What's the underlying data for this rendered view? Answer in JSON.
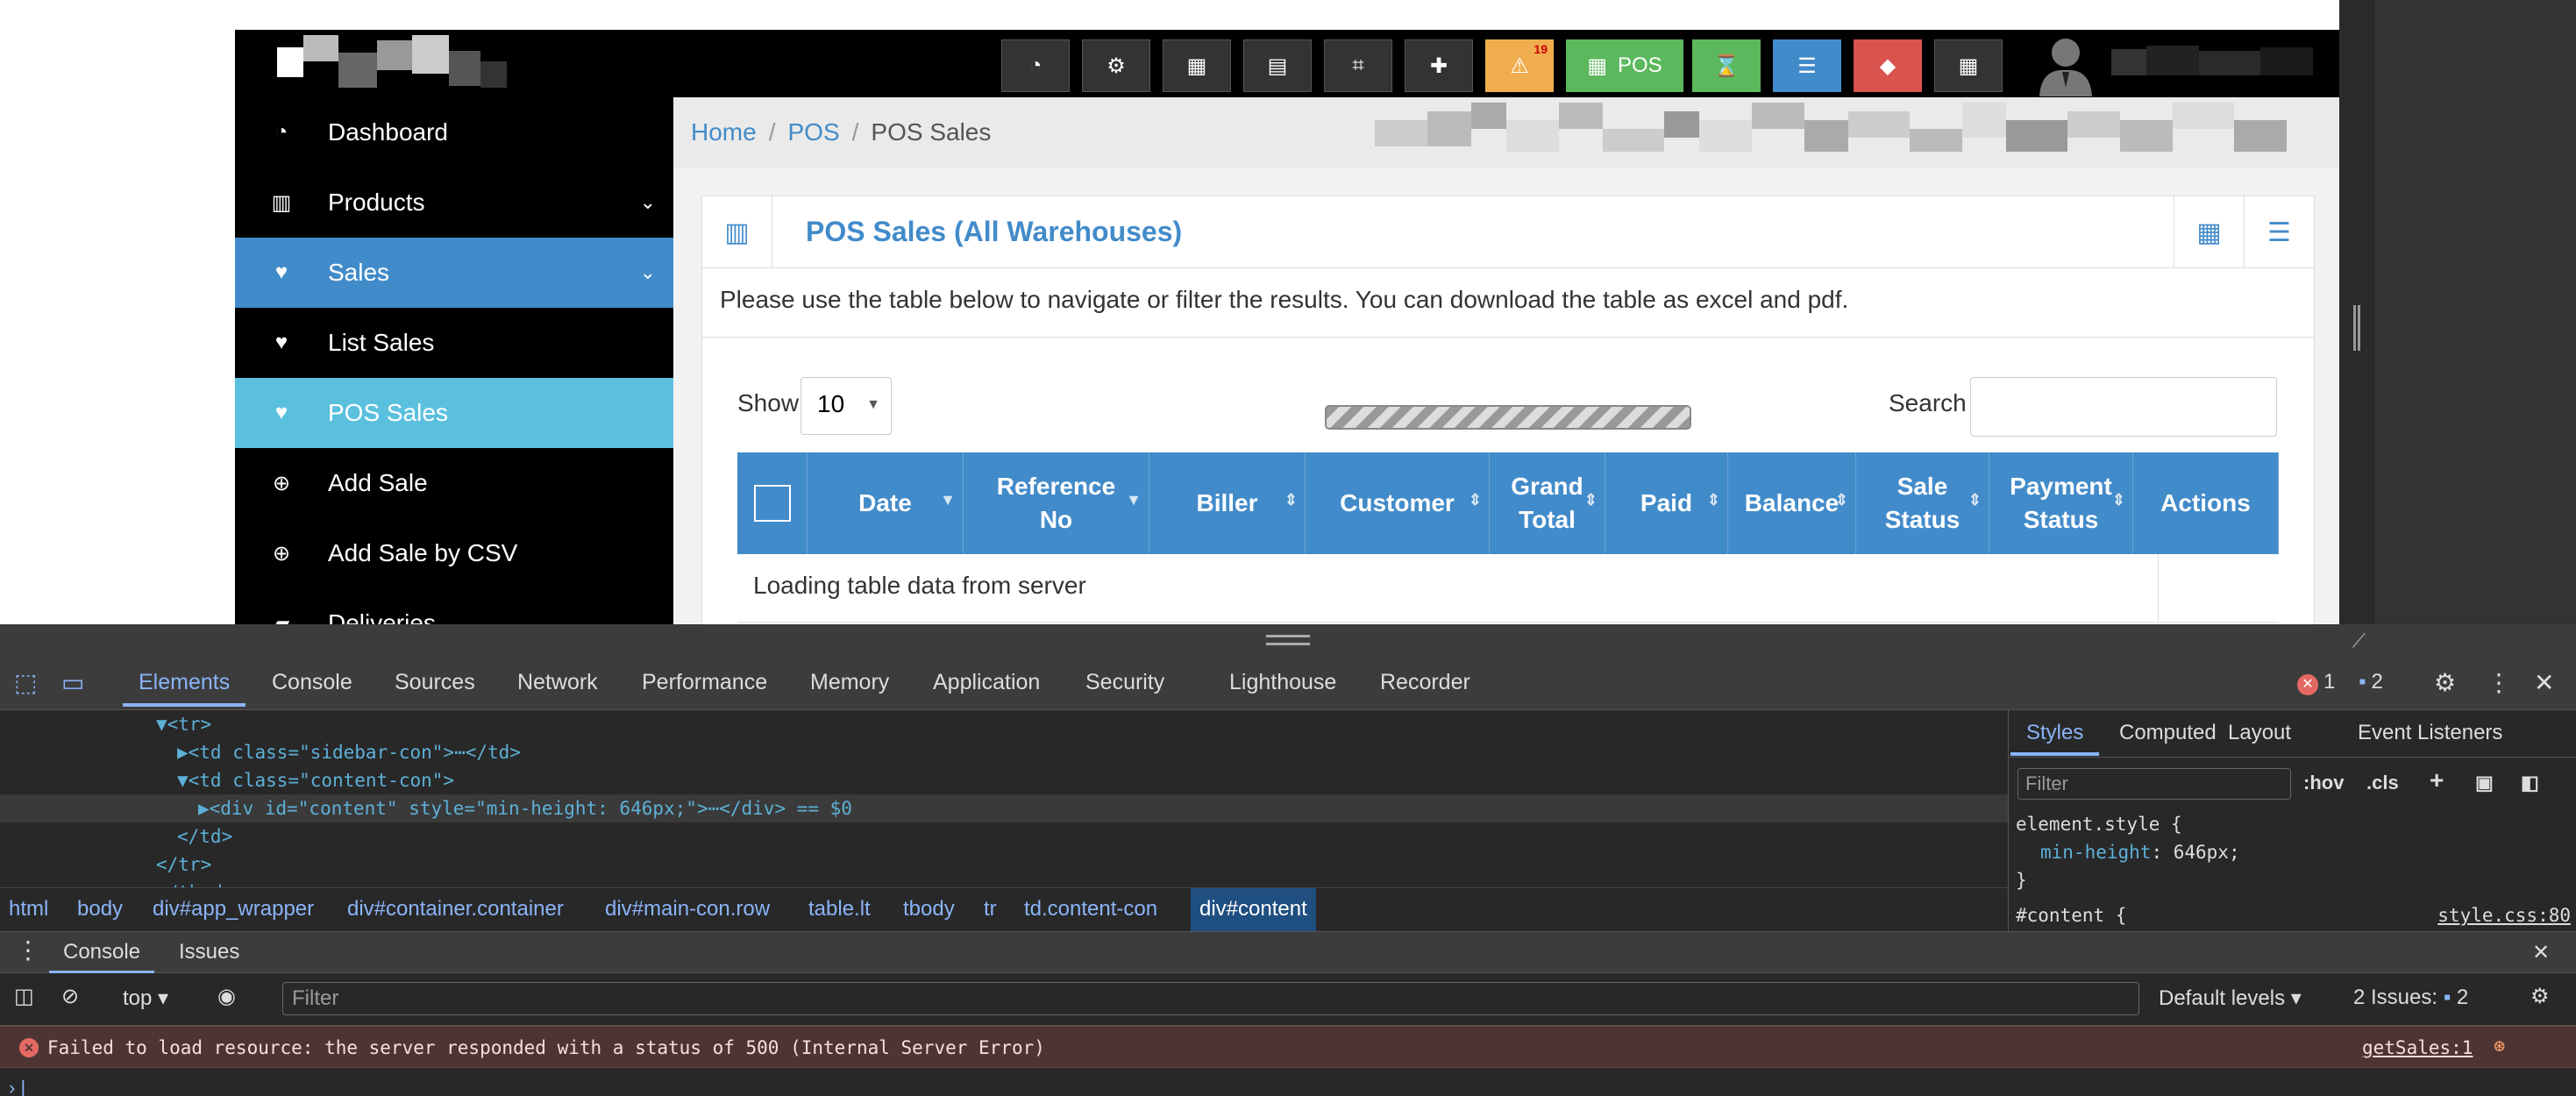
{
  "topbar": {
    "buttons": [
      {
        "icon": "dashboard-icon",
        "glyph": "◔"
      },
      {
        "icon": "cogs-icon",
        "glyph": "⚙"
      },
      {
        "icon": "calculator-icon",
        "glyph": "▦"
      },
      {
        "icon": "calendar-icon",
        "glyph": "▤"
      },
      {
        "icon": "css3-icon",
        "glyph": "⌗"
      },
      {
        "icon": "uk-flag-icon",
        "glyph": "✚"
      },
      {
        "icon": "alert-icon",
        "glyph": "⚠",
        "badge": "19"
      },
      {
        "icon": "pos-icon",
        "glyph": "▦",
        "label": "POS"
      },
      {
        "icon": "hourglass-icon",
        "glyph": "⌛"
      },
      {
        "icon": "list-icon",
        "glyph": "☰"
      },
      {
        "icon": "eraser-icon",
        "glyph": "◆"
      },
      {
        "icon": "grid-icon",
        "glyph": "▦"
      }
    ],
    "colors": {
      "alert": "#f0ad4e",
      "pos": "#5cb85c",
      "hourglass": "#5cb85c",
      "list": "#428bca",
      "eraser": "#d9534f",
      "default": "#333333"
    }
  },
  "sidebar": {
    "items": [
      {
        "label": "Dashboard",
        "icon": "dashboard-icon",
        "glyph": "◔"
      },
      {
        "label": "Products",
        "icon": "barcode-icon",
        "glyph": "▥",
        "chevron": "⌄"
      },
      {
        "label": "Sales",
        "icon": "heart-icon",
        "glyph": "♥",
        "chevron": "⌄"
      },
      {
        "label": "List Sales",
        "icon": "heart-icon",
        "glyph": "♥"
      },
      {
        "label": "POS Sales",
        "icon": "heart-icon",
        "glyph": "♥"
      },
      {
        "label": "Add Sale",
        "icon": "plus-circle-icon",
        "glyph": "⊕"
      },
      {
        "label": "Add Sale by CSV",
        "icon": "plus-circle-icon",
        "glyph": "⊕"
      },
      {
        "label": "Deliveries",
        "icon": "truck-icon",
        "glyph": "▰"
      }
    ]
  },
  "breadcrumb": {
    "home": "Home",
    "pos": "POS",
    "current": "POS Sales",
    "sep": "/"
  },
  "box": {
    "title": "POS Sales (All Warehouses)",
    "intro": "Please use the table below to navigate or filter the results. You can download the table as excel and pdf.",
    "show_label": "Show",
    "show_value": "10",
    "search_label": "Search",
    "columns": [
      "",
      "Date",
      "Reference\nNo",
      "Biller",
      "Customer",
      "Grand\nTotal",
      "Paid",
      "Balance",
      "Sale\nStatus",
      "Payment\nStatus",
      "Actions"
    ],
    "loading": "Loading table data from server"
  },
  "devtools": {
    "tabs": [
      "Elements",
      "Console",
      "Sources",
      "Network",
      "Performance",
      "Memory",
      "Application",
      "Security",
      "Lighthouse",
      "Recorder"
    ],
    "errors": "1",
    "issues": "2",
    "dom": [
      {
        "indent": 0,
        "text": "▼<tr>"
      },
      {
        "indent": 1,
        "text": "▶<td class=\"sidebar-con\">⋯</td>"
      },
      {
        "indent": 1,
        "text": "▼<td class=\"content-con\">"
      },
      {
        "indent": 2,
        "text": "▶<div id=\"content\" style=\"min-height: 646px;\">⋯</div> == $0"
      },
      {
        "indent": 1,
        "text": "</td>"
      },
      {
        "indent": 0,
        "text": "</tr>"
      },
      {
        "indent": 0,
        "text": "</tbody>"
      }
    ],
    "crumbs": [
      "html",
      "body",
      "div#app_wrapper",
      "div#container.container",
      "div#main-con.row",
      "table.lt",
      "tbody",
      "tr",
      "td.content-con",
      "div#content"
    ],
    "styles_tabs": [
      "Styles",
      "Computed",
      "Layout",
      "Event Listeners"
    ],
    "styles_filter": "Filter",
    "hov": ":hov",
    "cls": ".cls",
    "rule1_selector": "element.style {",
    "rule1_prop": "min-height",
    "rule1_val": "646px;",
    "rule2_selector": "#content {",
    "rule2_link": "style.css:80",
    "drawer_tabs": [
      "Console",
      "Issues"
    ],
    "context": "top",
    "console_filter": "Filter",
    "levels": "Default levels",
    "issues_label": "2 Issues:",
    "issues_count": "2",
    "error_message": "Failed to load resource: the server responded with a status of 500 (Internal Server Error)",
    "error_source": "getSales:1"
  }
}
